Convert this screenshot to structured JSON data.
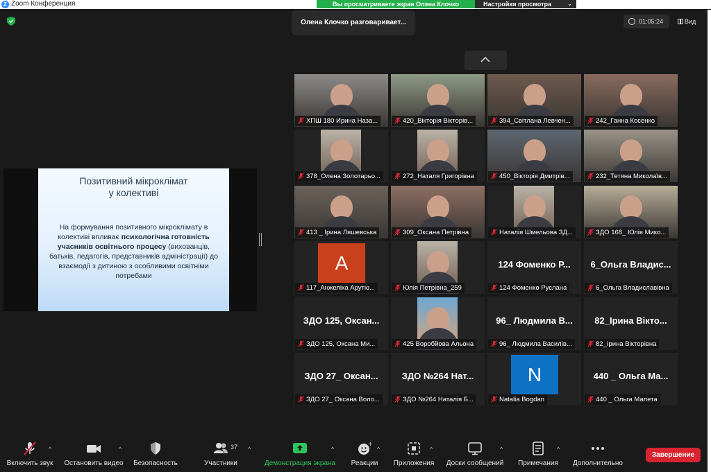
{
  "window": {
    "title": "Zoom Конференция"
  },
  "share_banner": {
    "message": "Вы просматриваете экран Олена Клочко",
    "view_options": "Настройки просмотра"
  },
  "speaker": {
    "text": "Олена Клочко разговаривает..."
  },
  "timer": {
    "value": "01:05:24"
  },
  "view": {
    "label": "Вид"
  },
  "slide": {
    "title_line1": "Позитивний мікроклімат",
    "title_line2": "у колективі",
    "body_part1": "На формування позитивного мікроклімату в колективі впливає ",
    "body_bold": "психологічна готовність учасників освітнього процесу",
    "body_part2": " (вихованців, батьків, педагогів, представників адміністрації) до взаємодії з дитиною з особливими освітніми потребами"
  },
  "participants": [
    {
      "label": "ХПШ 180  Ирина Наза...",
      "type": "video",
      "bg": "#8d8b89"
    },
    {
      "label": "420_Вікторія Вікторів...",
      "type": "video",
      "bg": "#8f9a86"
    },
    {
      "label": "394_Світлана Левчен...",
      "type": "video",
      "bg": "#6f5a4e"
    },
    {
      "label": "242_Ганна Косенко",
      "type": "video",
      "bg": "#8b6b5f"
    },
    {
      "label": "378_Олена Золотарьо...",
      "type": "video",
      "bg": "#272727"
    },
    {
      "label": "272_Наталя Григорівна",
      "type": "video",
      "bg": "#2a2a2a"
    },
    {
      "label": "450_Вікторія Дмитрів...",
      "type": "video",
      "bg": "#5d6670"
    },
    {
      "label": "232_Тетяна Миколаїв...",
      "type": "video",
      "bg": "#9a9488"
    },
    {
      "label": "413 _ Ірина Ляшевська",
      "type": "video",
      "bg": "#6b625a"
    },
    {
      "label": "309_Оксана Петрівна",
      "type": "video",
      "bg": "#8f6f63"
    },
    {
      "label": "Наталія Шмельова ЗД...",
      "type": "video",
      "bg": "#272727"
    },
    {
      "label": "ЗДО 168_ Юлія Мико...",
      "type": "video",
      "bg": "#b7ad98"
    },
    {
      "label": "117_Анжеліка Арутю...",
      "type": "avatar",
      "avatar_letter": "A",
      "avatar_color": "#c9401d"
    },
    {
      "label": "Юлія Петрівна_259",
      "type": "video",
      "bg": "#272727"
    },
    {
      "label": "124 Фоменко Руслана",
      "type": "name",
      "bigname": "124 Фоменко Р..."
    },
    {
      "label": "6_Ольга Владиславівна",
      "type": "name",
      "bigname": "6_Ольга  Владис..."
    },
    {
      "label": "ЗДО 125, Оксана Ми...",
      "type": "name",
      "bigname": "ЗДО 125,  Оксан..."
    },
    {
      "label": "425 Воробйова Альона",
      "type": "photo",
      "bg": "#272727"
    },
    {
      "label": "96_ Людмила Василів...",
      "type": "name",
      "bigname": "96_  Людмила В..."
    },
    {
      "label": "82_Ірина Вікторівна",
      "type": "name",
      "bigname": "82_Ірина  Вікто..."
    },
    {
      "label": "ЗДО 27_ Оксана Воло...",
      "type": "name",
      "bigname": "ЗДО 27_ Оксан..."
    },
    {
      "label": "ЗДО №264 Наталія Б...",
      "type": "name",
      "bigname": "ЗДО №264  Нат..."
    },
    {
      "label": "Natalia Bogdan",
      "type": "avatar",
      "avatar_letter": "N",
      "avatar_color": "#0e72c4"
    },
    {
      "label": "440 _ Ольга Малета",
      "type": "name",
      "bigname": "440 _ Ольга Ма..."
    }
  ],
  "toolbar": {
    "mute": "Включить звук",
    "video": "Остановить видео",
    "security": "Безопасность",
    "participants": "Участники",
    "participants_count": "37",
    "share": "Демонстрация экрана",
    "reactions": "Реакции",
    "apps": "Приложения",
    "whiteboards": "Доски сообщений",
    "notes": "Примечания",
    "more": "Дополнительно",
    "end": "Завершение"
  },
  "colors": {
    "share_green": "#23b04a",
    "end_red": "#d9232f",
    "active_green": "#2ec55b"
  }
}
